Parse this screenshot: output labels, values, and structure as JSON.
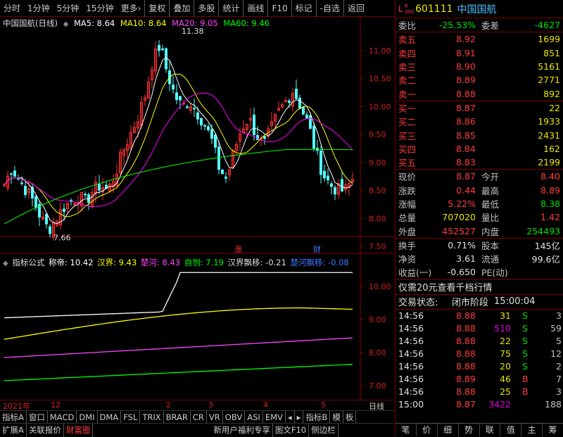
{
  "toolbar": {
    "items": [
      "分时",
      "1分钟",
      "5分钟",
      "15分钟",
      "更多›",
      "复权",
      "叠加",
      "多股",
      "统计",
      "画线",
      "F10",
      "标记",
      "-自选",
      "返回"
    ]
  },
  "chart": {
    "title": "中国国航(日线)",
    "ma5": "MA5: 8.64",
    "ma10": "MA10: 8.64",
    "ma20": "MA20: 9.05",
    "ma60": "MA60: 9.46",
    "price_labels": [
      "11.00",
      "10.50",
      "10.00",
      "9.50",
      "9.00",
      "8.50",
      "8.00",
      "7.50"
    ],
    "high_mark": "11.38",
    "low_mark": "7.66",
    "zhang": "涨",
    "cai": "财",
    "colors": {
      "ma5": "#ffffff",
      "ma10": "#ffff00",
      "ma20": "#ff00ff",
      "ma60": "#00ff00",
      "up": "#ff3232",
      "down": "#54ffff"
    }
  },
  "indicator": {
    "title": "指标公式",
    "chengdi": "称帝: 10.42",
    "hanjie": "汉界: 9.43",
    "chuhe": "楚河: 8.43",
    "ziji": "自刎: 7.19",
    "hanpiao": "汉界飘移: -0.21",
    "chupiao": "楚河飘移: -0.08",
    "axis": [
      "10.00",
      "9.00",
      "8.00",
      "7.00"
    ]
  },
  "timebar": {
    "labels": [
      "2021年",
      "12",
      "2",
      "3",
      "4",
      "5"
    ],
    "period": "日线"
  },
  "tabs": [
    "指标A",
    "窗口",
    "MACD",
    "DMI",
    "DMA",
    "FSL",
    "TRIX",
    "BRAR",
    "CR",
    "VR",
    "OBV",
    "ASI",
    "EMV",
    "◂",
    "▸",
    "指标B",
    "模",
    "板"
  ],
  "bottombar": [
    "扩展A",
    "关联报价",
    "财富圈",
    "新用户福利专享",
    "图文F10",
    "侧边栏"
  ],
  "stock": {
    "code": "601111",
    "name": "中国国航",
    "prefix_l": "L",
    "prefix_r": "R",
    "prefix_num": "300"
  },
  "weibi": {
    "label": "委比",
    "value": "-25.53%",
    "label2": "委差",
    "value2": "-4627"
  },
  "asks": [
    {
      "label": "卖五",
      "price": "8.92",
      "vol": "1699"
    },
    {
      "label": "卖四",
      "price": "8.91",
      "vol": "851"
    },
    {
      "label": "卖三",
      "price": "8.90",
      "vol": "5161"
    },
    {
      "label": "卖二",
      "price": "8.89",
      "vol": "2771"
    },
    {
      "label": "卖一",
      "price": "8.88",
      "vol": "892"
    }
  ],
  "bids": [
    {
      "label": "买一",
      "price": "8.87",
      "vol": "22"
    },
    {
      "label": "买二",
      "price": "8.86",
      "vol": "1933"
    },
    {
      "label": "买三",
      "price": "8.85",
      "vol": "2431"
    },
    {
      "label": "买四",
      "price": "8.84",
      "vol": "162"
    },
    {
      "label": "买五",
      "price": "8.83",
      "vol": "2199"
    }
  ],
  "quote": [
    {
      "l1": "现价",
      "v1": "8.87",
      "l2": "今开",
      "v2": "8.40"
    },
    {
      "l1": "涨跌",
      "v1": "0.44",
      "l2": "最高",
      "v2": "8.89"
    },
    {
      "l1": "涨幅",
      "v1": "5.22%",
      "l2": "最低",
      "v2": "8.38"
    },
    {
      "l1": "总量",
      "v1": "707020",
      "l2": "量比",
      "v2": "1.42"
    },
    {
      "l1": "外盘",
      "v1": "452527",
      "l2": "内盘",
      "v2": "254493"
    }
  ],
  "fund": [
    {
      "l1": "换手",
      "v1": "0.71%",
      "l2": "股本",
      "v2": "145亿"
    },
    {
      "l1": "净资",
      "v1": "3.61",
      "l2": "流通",
      "v2": "99.6亿"
    },
    {
      "l1": "收益(一)",
      "v1": "-0.650",
      "l2": "PE(动)",
      "v2": ""
    }
  ],
  "promo": "仅需20元查看千档行情",
  "status": {
    "label": "交易状态:",
    "value": "闭市阶段",
    "time": "15:00:04"
  },
  "trades": [
    {
      "t": "14:56",
      "p": "8.88",
      "v": "31",
      "s": "S",
      "n": "3"
    },
    {
      "t": "14:56",
      "p": "8.88",
      "v": "510",
      "s": "S",
      "n": "59"
    },
    {
      "t": "14:56",
      "p": "8.88",
      "v": "22",
      "s": "S",
      "n": "5"
    },
    {
      "t": "14:56",
      "p": "8.88",
      "v": "75",
      "s": "S",
      "n": "12"
    },
    {
      "t": "14:56",
      "p": "8.88",
      "v": "20",
      "s": "S",
      "n": "2"
    },
    {
      "t": "14:56",
      "p": "8.89",
      "v": "46",
      "s": "B",
      "n": "7"
    },
    {
      "t": "14:56",
      "p": "8.88",
      "v": "25",
      "s": "B",
      "n": "3"
    },
    {
      "t": "15:00",
      "p": "8.87",
      "v": "3422",
      "s": "",
      "n": "188"
    }
  ],
  "rbottom": [
    "笔",
    "价",
    "细",
    "势",
    "联",
    "值",
    "主",
    "筹"
  ]
}
